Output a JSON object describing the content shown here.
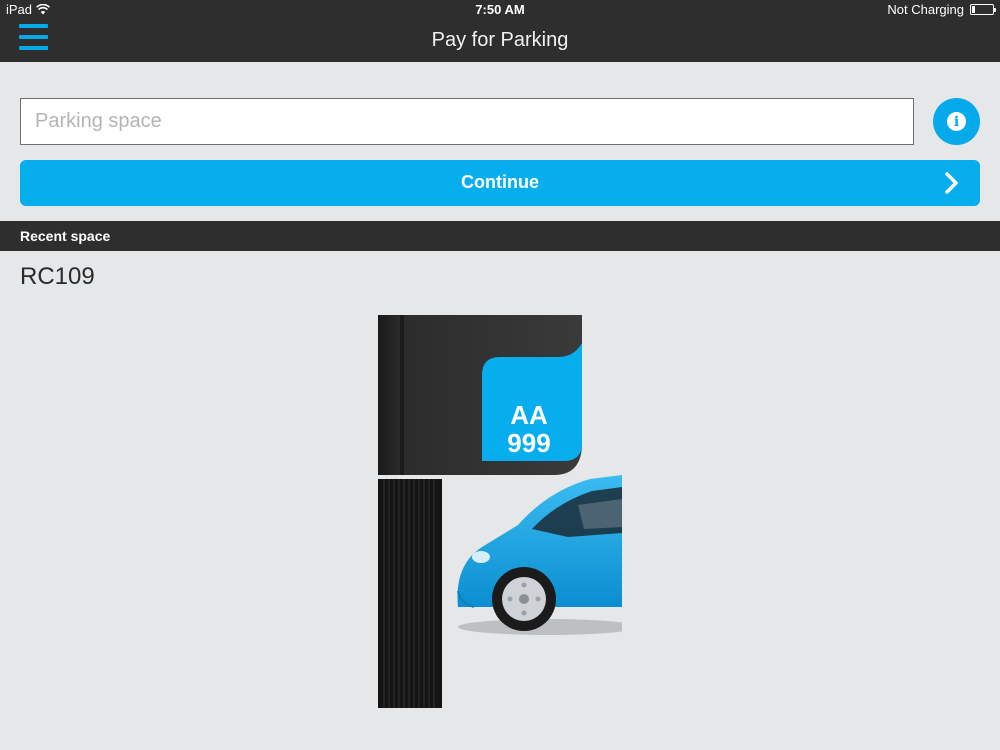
{
  "status_bar": {
    "device": "iPad",
    "time": "7:50 AM",
    "battery_status": "Not Charging"
  },
  "nav": {
    "title": "Pay for Parking",
    "menu_icon": "hamburger-menu-icon"
  },
  "form": {
    "space_input": {
      "value": "",
      "placeholder": "Parking space"
    },
    "info_icon": "info-icon",
    "continue_label": "Continue",
    "continue_icon": "chevron-right-icon"
  },
  "recent": {
    "header": "Recent space",
    "items": [
      "RC109"
    ]
  },
  "illustration": {
    "plate_line1": "AA",
    "plate_line2": "999"
  },
  "colors": {
    "accent": "#06aeee",
    "bar": "#2e2e2e",
    "background": "#e6e7e9",
    "car": "#1ea6e4"
  }
}
